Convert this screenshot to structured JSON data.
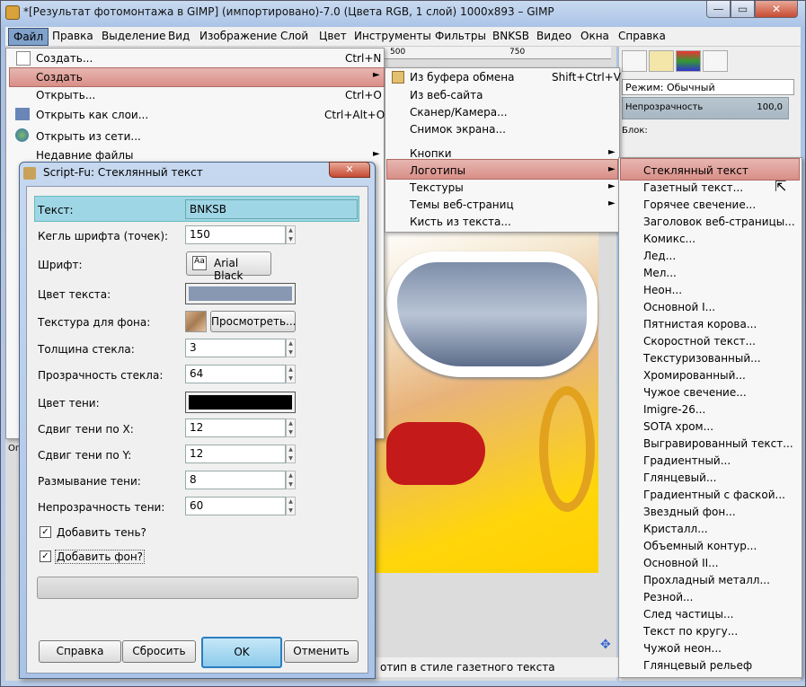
{
  "window": {
    "title": "*[Результат фотомонтажа в GIMP] (импортировано)-7.0 (Цвета RGB, 1 слой) 1000x893 – GIMP"
  },
  "menubar": [
    "Файл",
    "Правка",
    "Выделение",
    "Вид",
    "Изображение",
    "Слой",
    "Цвет",
    "Инструменты",
    "Фильтры",
    "BNKSB",
    "Видео",
    "Окна",
    "Справка"
  ],
  "ruler": {
    "mark1": "500",
    "mark2": "750"
  },
  "file_menu": [
    {
      "label": "Создать...",
      "shortcut": "Ctrl+N"
    },
    {
      "label": "Создать",
      "shortcut": ""
    },
    {
      "label": "Открыть...",
      "shortcut": "Ctrl+O"
    },
    {
      "label": "Открыть как слои...",
      "shortcut": "Ctrl+Alt+O"
    },
    {
      "label": "Открыть из сети...",
      "shortcut": ""
    },
    {
      "label": "Недавние файлы",
      "shortcut": ""
    }
  ],
  "create_menu": [
    {
      "label": "Из буфера обмена",
      "shortcut": "Shift+Ctrl+V"
    },
    {
      "label": "Из веб-сайта",
      "shortcut": ""
    },
    {
      "label": "Сканер/Камера...",
      "shortcut": ""
    },
    {
      "label": "Снимок экрана...",
      "shortcut": ""
    },
    {
      "label": "Кнопки",
      "shortcut": ""
    },
    {
      "label": "Логотипы",
      "shortcut": ""
    },
    {
      "label": "Текстуры",
      "shortcut": ""
    },
    {
      "label": "Темы веб-страниц",
      "shortcut": ""
    },
    {
      "label": "Кисть из текста...",
      "shortcut": ""
    }
  ],
  "logos_menu": [
    "Стеклянный текст",
    "Газетный текст...",
    "Горячее свечение...",
    "Заголовок веб-страницы...",
    "Комикс...",
    "Лед...",
    "Мел...",
    "Неон...",
    "Основной I...",
    "Пятнистая корова...",
    "Скоростной текст...",
    "Текстуризованный...",
    "Хромированный...",
    "Чужое свечение...",
    "Imigre-26...",
    "SOTA хром...",
    "Выгравированный текст...",
    "Градиентный...",
    "Глянцевый...",
    "Градиентный с фаской...",
    "Звездный фон...",
    "Кристалл...",
    "Объемный контур...",
    "Основной II...",
    "Прохладный металл...",
    "Резной...",
    "След частицы...",
    "Текст по кругу...",
    "Чужой неон...",
    "Глянцевый рельеф"
  ],
  "dock": {
    "mode": "Режим: Обычный",
    "opacity_label": "Непрозрачность",
    "opacity_value": "100,0",
    "lock_label": "Блок:"
  },
  "status": {
    "text": "отип в стиле газетного текста",
    "left_fragment": "Ог"
  },
  "dialog": {
    "title": "Script-Fu: Стеклянный текст",
    "close": "✕",
    "text_label": "Текст:",
    "text_value": "BNKSB",
    "font_size_label": "Кегль шрифта (точек):",
    "font_size_value": "150",
    "font_label": "Шрифт:",
    "font_value": "Arial Black",
    "text_color_label": "Цвет текста:",
    "texture_label": "Текстура для фона:",
    "browse_label": "Просмотреть...",
    "glass_thickness_label": "Толщина стекла:",
    "glass_thickness_value": "3",
    "glass_transparency_label": "Прозрачность стекла:",
    "glass_transparency_value": "64",
    "shadow_color_label": "Цвет тени:",
    "shadow_x_label": "Сдвиг тени по X:",
    "shadow_x_value": "12",
    "shadow_y_label": "Сдвиг тени по Y:",
    "shadow_y_value": "12",
    "shadow_blur_label": "Размывание тени:",
    "shadow_blur_value": "8",
    "shadow_opacity_label": "Непрозрачность тени:",
    "shadow_opacity_value": "60",
    "add_shadow_label": "Добавить тень?",
    "add_shadow_checked": true,
    "add_bg_label": "Добавить фон?",
    "add_bg_checked": true,
    "help_btn": "Справка",
    "reset_btn": "Сбросить",
    "ok_btn": "OK",
    "cancel_btn": "Отменить",
    "text_color": "#8898b3",
    "shadow_color": "#000000"
  }
}
